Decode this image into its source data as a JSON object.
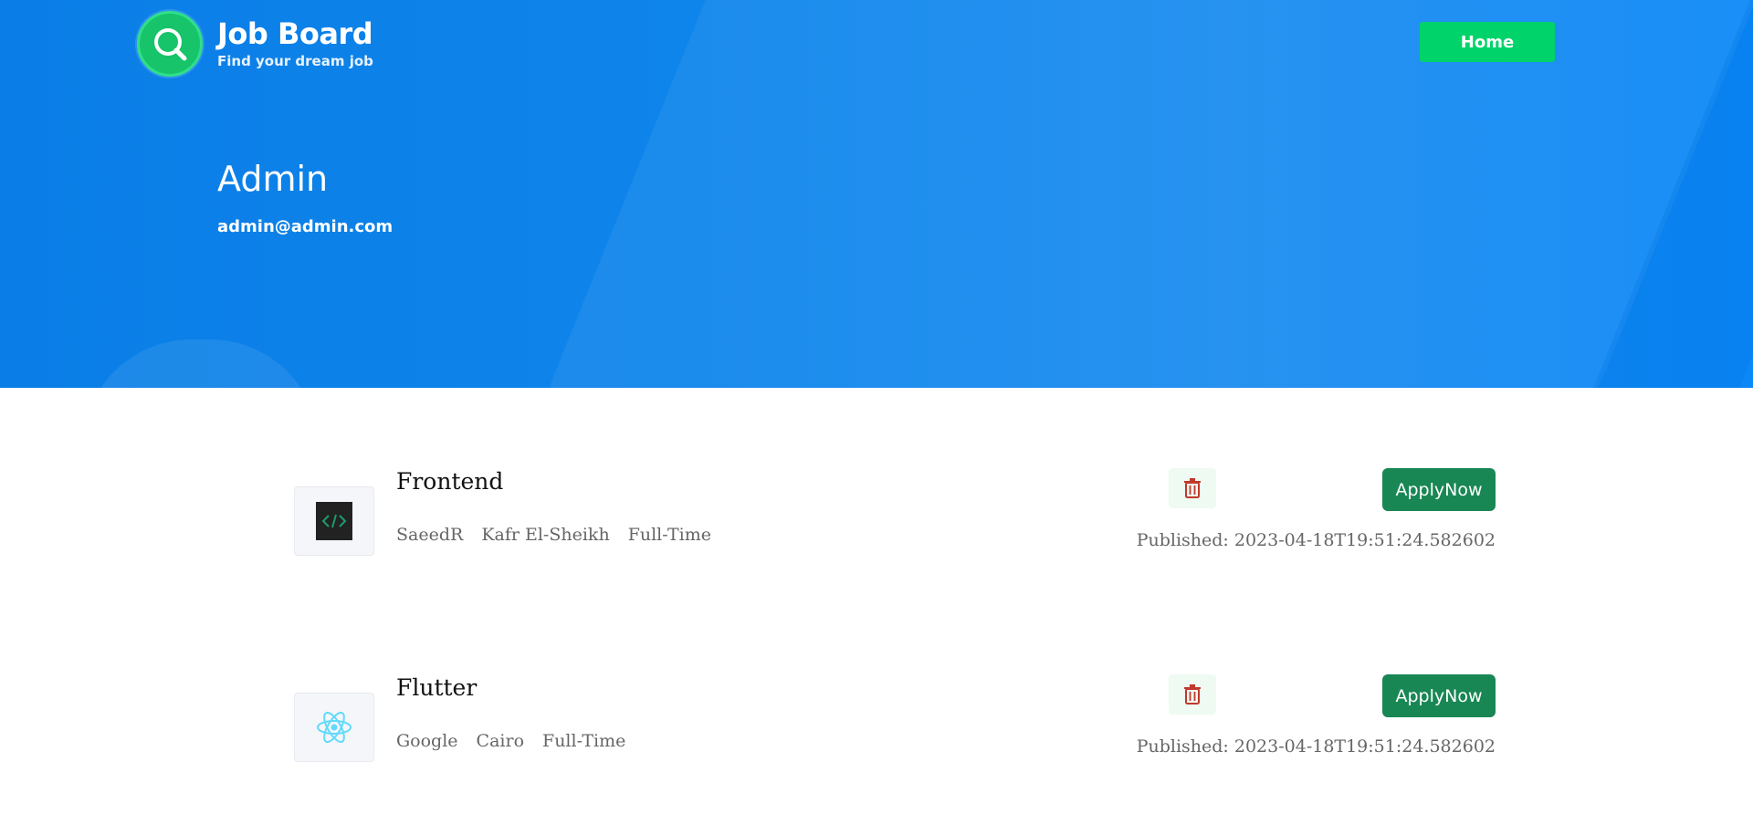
{
  "brand": {
    "title": "Job Board",
    "subtitle": "Find your dream job",
    "logo_icon": "search-icon",
    "accent": "#00d36a"
  },
  "nav": {
    "home_label": "Home"
  },
  "profile": {
    "name": "Admin",
    "email": "admin@admin.com"
  },
  "jobs": [
    {
      "title": "Frontend",
      "company": "SaeedR",
      "location": "Kafr El-Sheikh",
      "type": "Full-Time",
      "logo_icon": "code-icon",
      "apply_label": "ApplyNow",
      "published": "Published: 2023-04-18T19:51:24.582602",
      "delete_icon": "trash-icon"
    },
    {
      "title": "Flutter",
      "company": "Google",
      "location": "Cairo",
      "type": "Full-Time",
      "logo_icon": "react-icon",
      "apply_label": "ApplyNow",
      "published": "Published: 2023-04-18T19:51:24.582602",
      "delete_icon": "trash-icon"
    }
  ],
  "colors": {
    "hero": "#0f86ec",
    "apply": "#198754",
    "delete": "#c0392b"
  }
}
